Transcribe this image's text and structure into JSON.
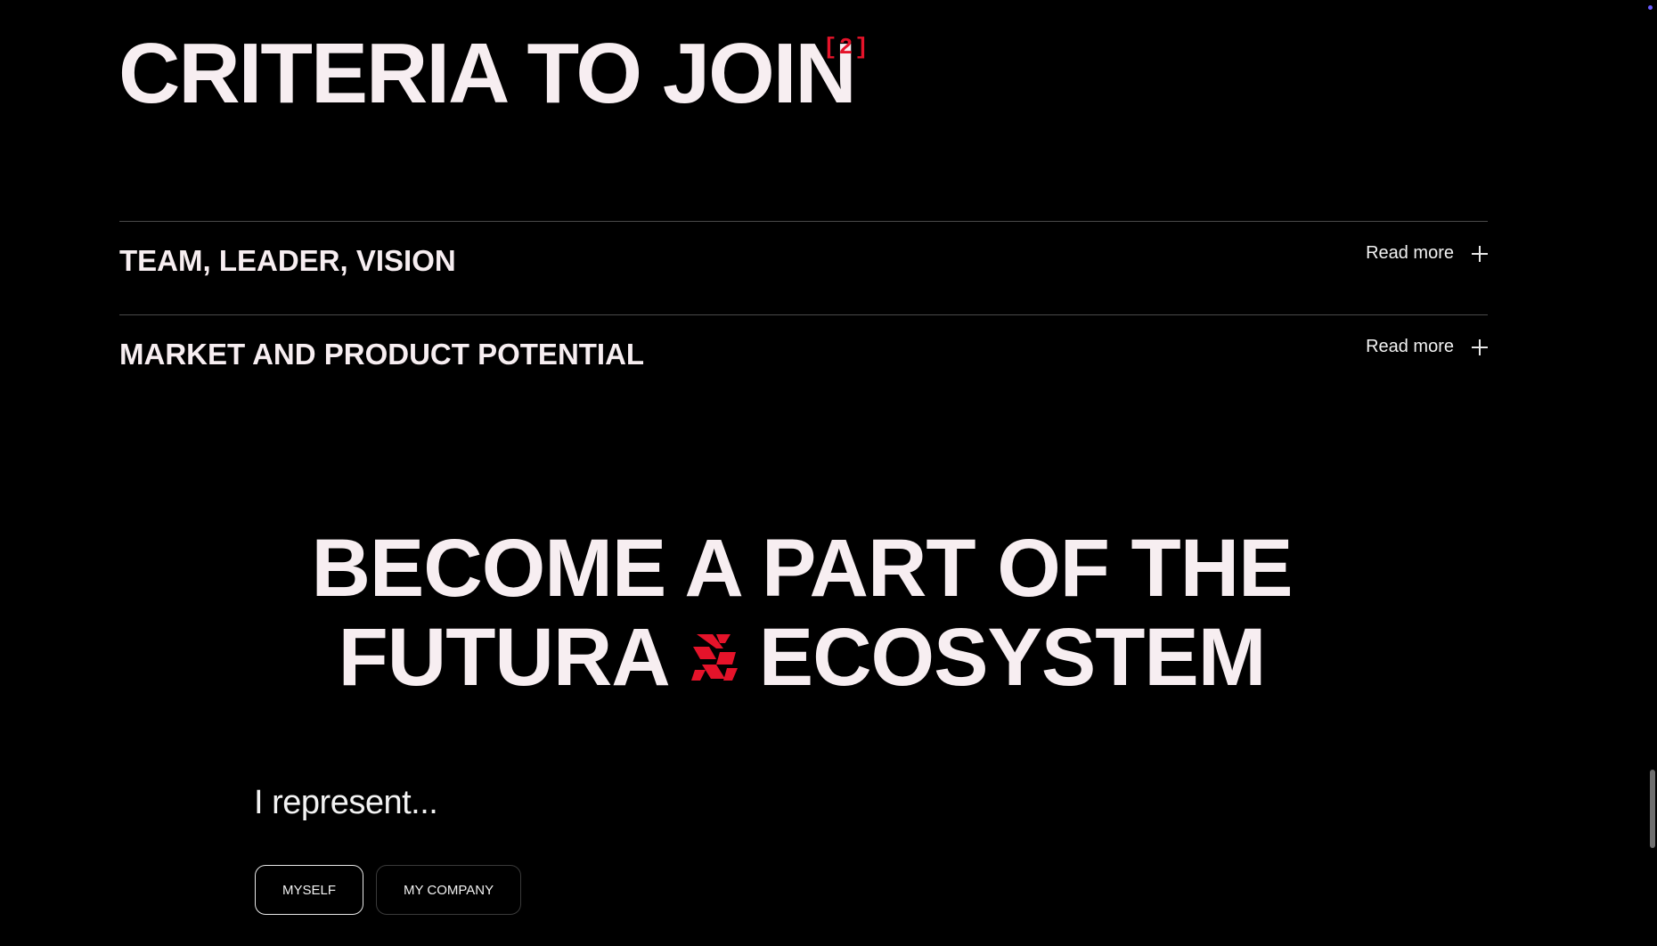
{
  "criteria": {
    "title": "CRITERIA TO JOIN",
    "index": "[2]"
  },
  "accordion": {
    "items": [
      {
        "title": "TEAM, LEADER, VISION",
        "toggle_label": "Read more",
        "icon": "plus-icon"
      },
      {
        "title": "MARKET AND PRODUCT POTENTIAL",
        "toggle_label": "Read more",
        "icon": "plus-icon"
      }
    ]
  },
  "cta": {
    "line1": "BECOME A PART OF THE",
    "line2_before": "FUTURA",
    "line2_after": "ECOSYSTEM",
    "logo_icon": "futura-logo-icon"
  },
  "represent": {
    "label": "I represent...",
    "options": [
      {
        "label": "MYSELF",
        "selected": true
      },
      {
        "label": "MY COMPANY",
        "selected": false
      }
    ]
  },
  "colors": {
    "background": "#000000",
    "text": "#f7eef1",
    "accent": "#e5132a",
    "divider": "#4a4a4a"
  }
}
